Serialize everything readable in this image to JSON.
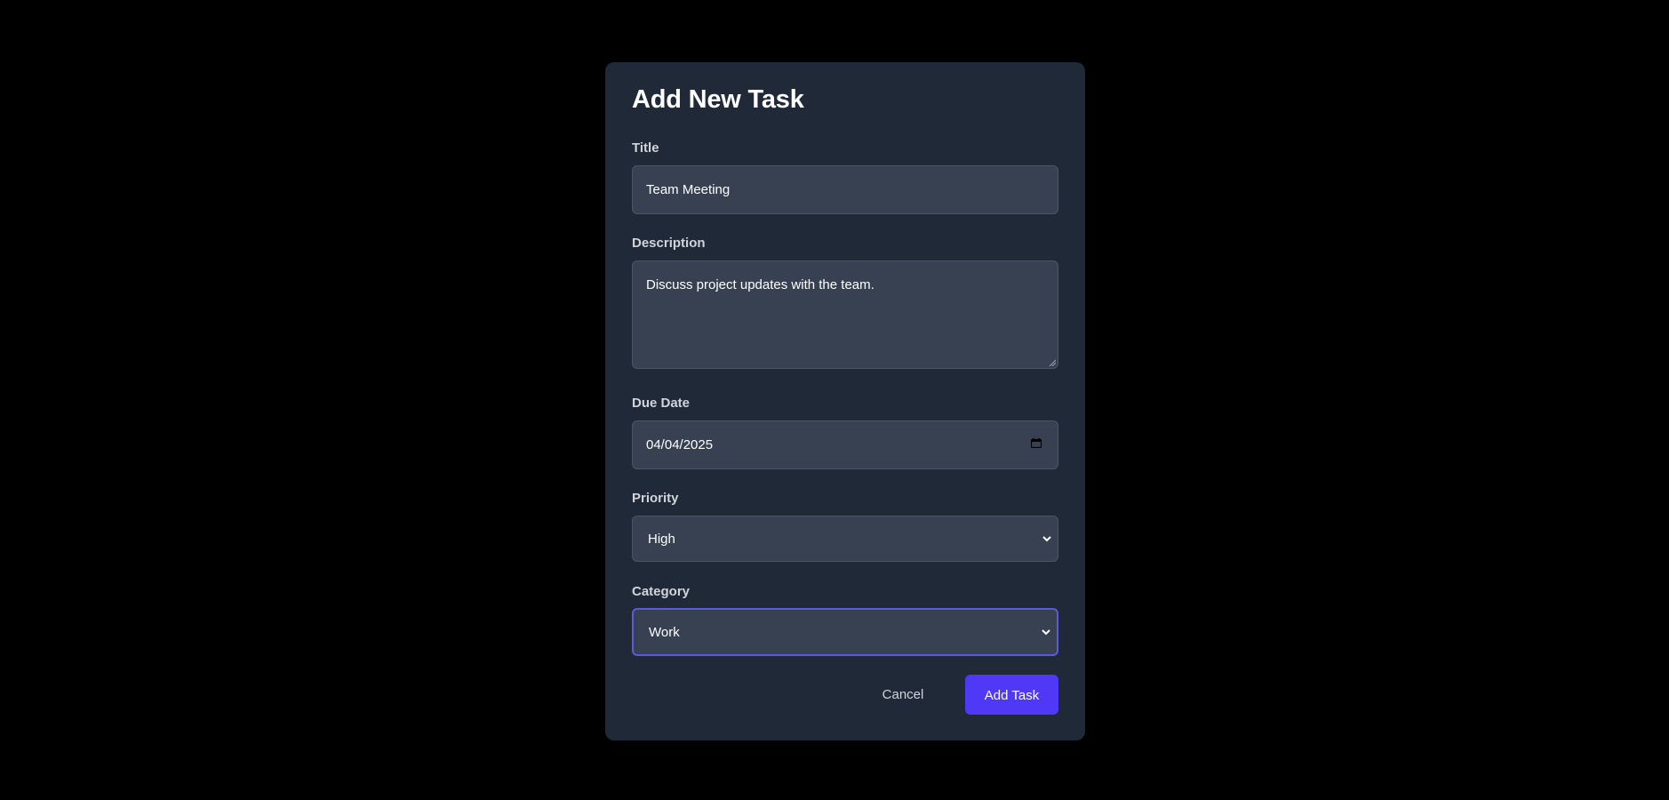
{
  "modal": {
    "title": "Add New Task"
  },
  "fields": {
    "title": {
      "label": "Title",
      "value": "Team Meeting"
    },
    "description": {
      "label": "Description",
      "value": "Discuss project updates with the team."
    },
    "due_date": {
      "label": "Due Date",
      "value": "04/04/2025",
      "icon": "calendar-icon"
    },
    "priority": {
      "label": "Priority",
      "selected": "High",
      "icon": "chevron-down-icon"
    },
    "category": {
      "label": "Category",
      "selected": "Work",
      "icon": "chevron-down-icon",
      "focused": true
    }
  },
  "actions": {
    "cancel_label": "Cancel",
    "submit_label": "Add Task"
  },
  "colors": {
    "backdrop": "#000000",
    "modal_bg": "#1f2937",
    "input_bg": "#374151",
    "input_border": "#4b5563",
    "focus_ring": "#5b5bd6",
    "primary_button": "#4f39f6",
    "label_text": "#d1d5db",
    "title_text": "#ffffff"
  }
}
